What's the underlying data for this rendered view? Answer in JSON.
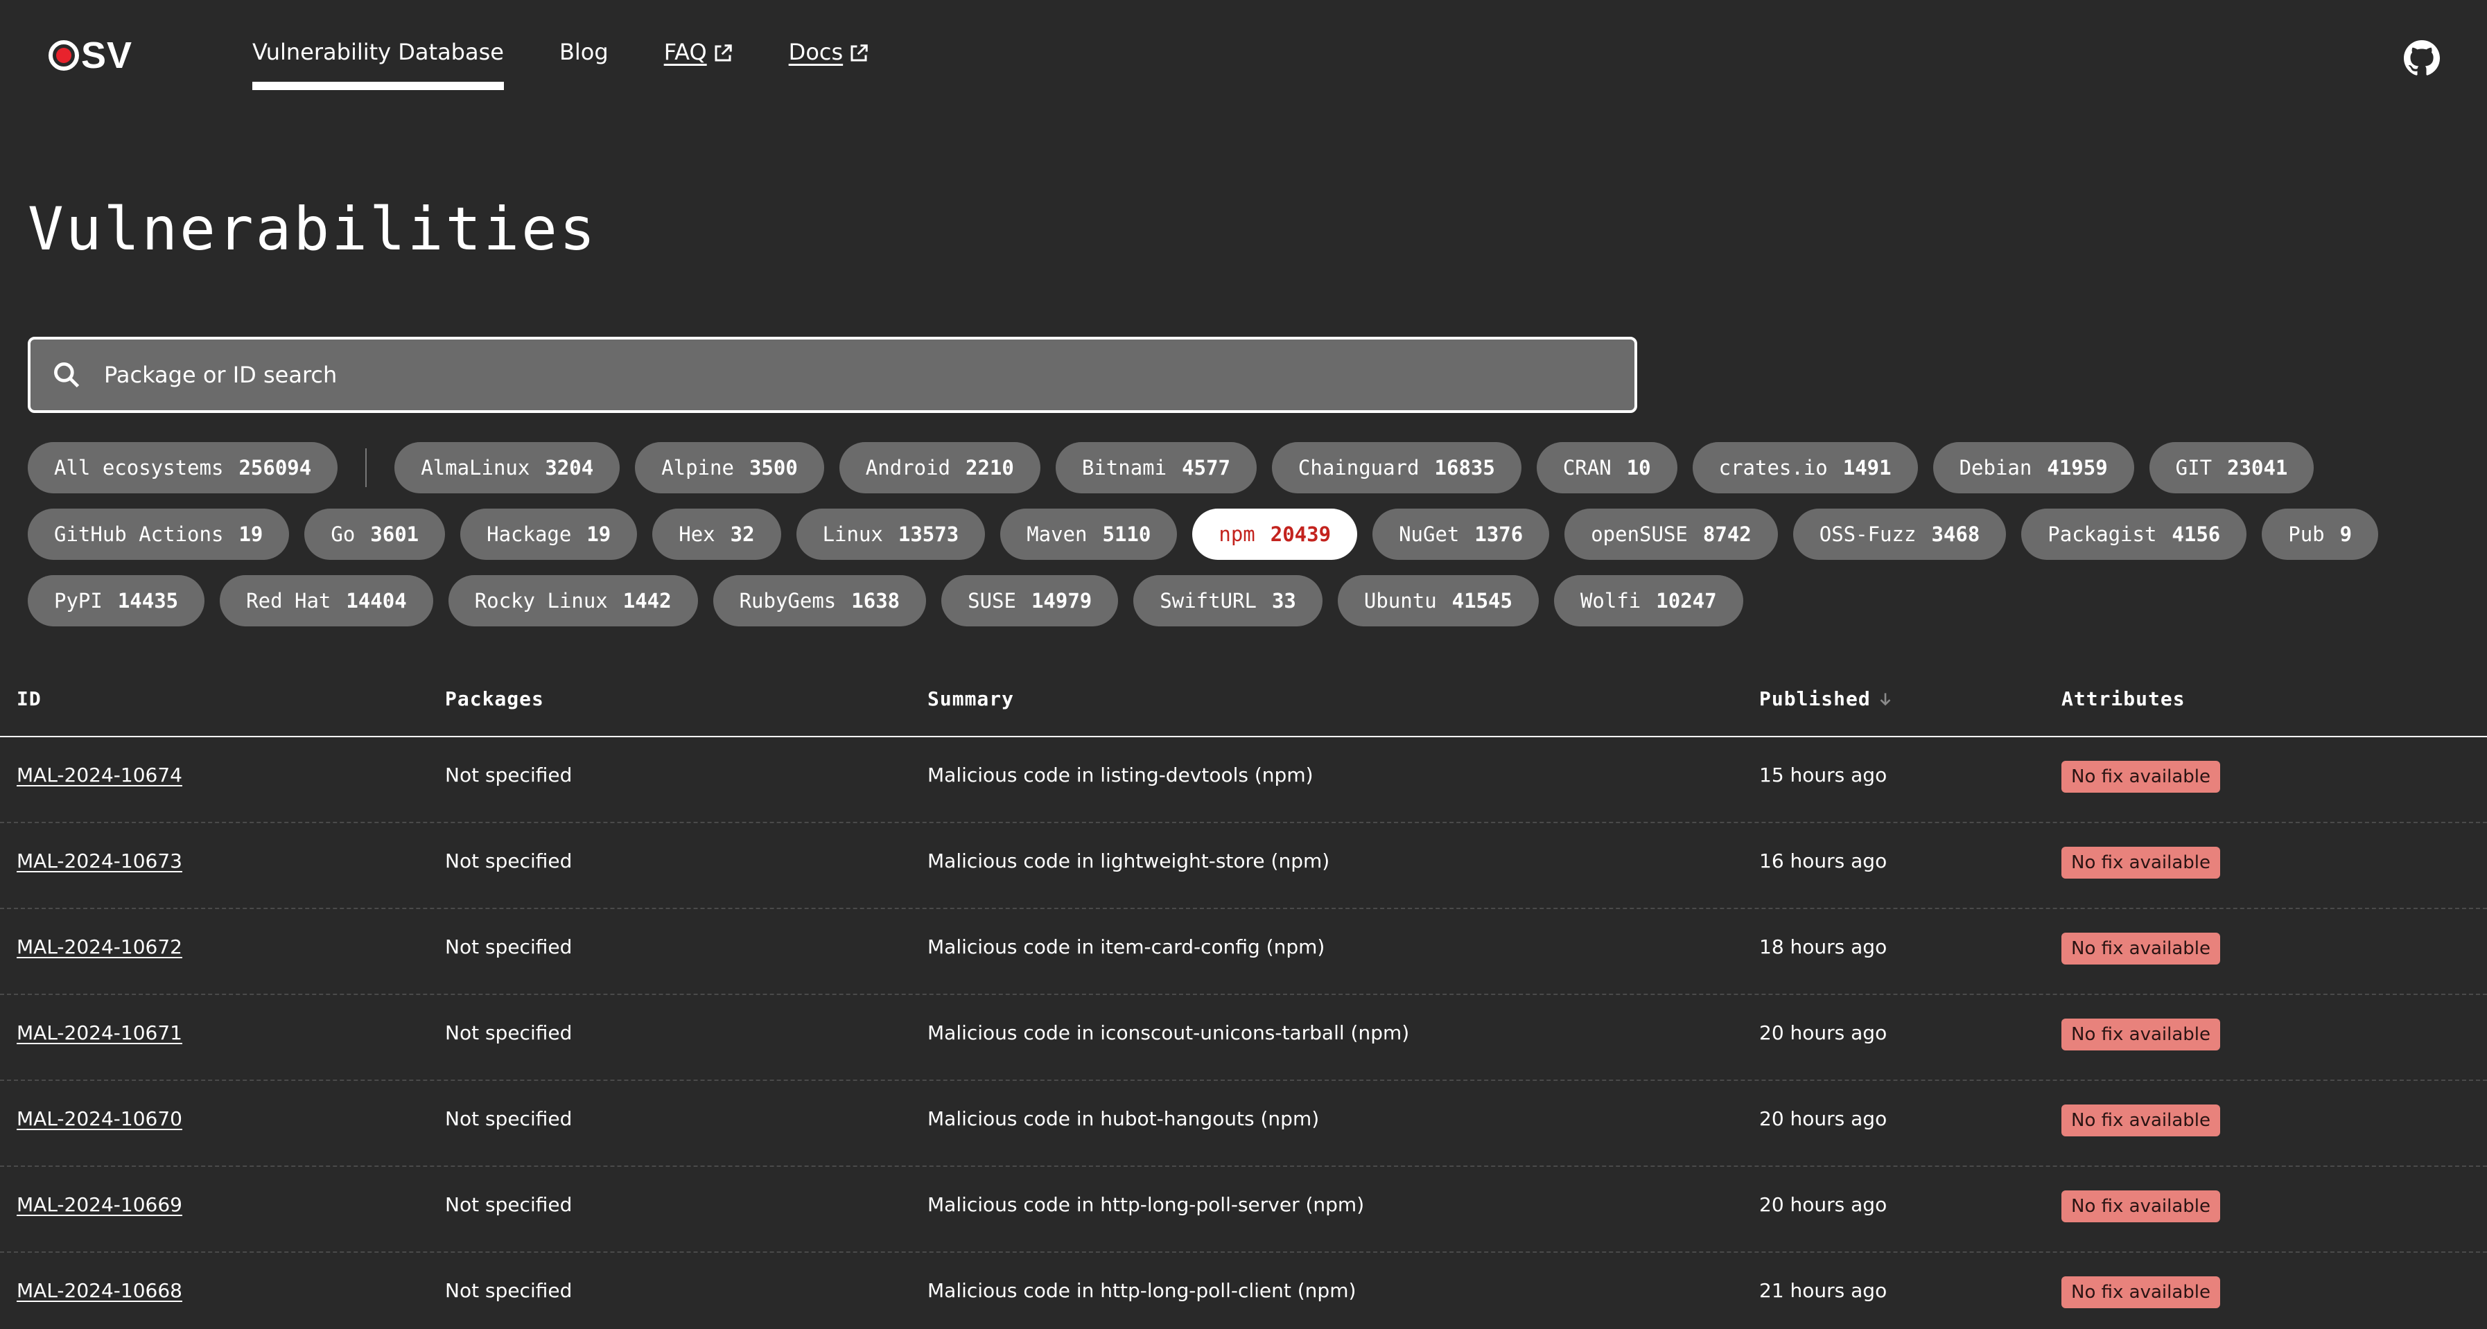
{
  "header": {
    "logo_text": "SV",
    "nav": [
      {
        "label": "Vulnerability Database",
        "active": true,
        "external": false
      },
      {
        "label": "Blog",
        "active": false,
        "external": false
      },
      {
        "label": "FAQ",
        "active": false,
        "external": true
      },
      {
        "label": "Docs",
        "active": false,
        "external": true
      }
    ]
  },
  "page": {
    "title": "Vulnerabilities"
  },
  "search": {
    "placeholder": "Package or ID search",
    "value": ""
  },
  "ecosystems": {
    "all": {
      "label": "All ecosystems",
      "count": "256094"
    },
    "items": [
      {
        "label": "AlmaLinux",
        "count": "3204"
      },
      {
        "label": "Alpine",
        "count": "3500"
      },
      {
        "label": "Android",
        "count": "2210"
      },
      {
        "label": "Bitnami",
        "count": "4577"
      },
      {
        "label": "Chainguard",
        "count": "16835"
      },
      {
        "label": "CRAN",
        "count": "10"
      },
      {
        "label": "crates.io",
        "count": "1491"
      },
      {
        "label": "Debian",
        "count": "41959"
      },
      {
        "label": "GIT",
        "count": "23041"
      },
      {
        "label": "GitHub Actions",
        "count": "19"
      },
      {
        "label": "Go",
        "count": "3601"
      },
      {
        "label": "Hackage",
        "count": "19"
      },
      {
        "label": "Hex",
        "count": "32"
      },
      {
        "label": "Linux",
        "count": "13573"
      },
      {
        "label": "Maven",
        "count": "5110"
      },
      {
        "label": "npm",
        "count": "20439",
        "selected": true
      },
      {
        "label": "NuGet",
        "count": "1376"
      },
      {
        "label": "openSUSE",
        "count": "8742"
      },
      {
        "label": "OSS-Fuzz",
        "count": "3468"
      },
      {
        "label": "Packagist",
        "count": "4156"
      },
      {
        "label": "Pub",
        "count": "9"
      },
      {
        "label": "PyPI",
        "count": "14435"
      },
      {
        "label": "Red Hat",
        "count": "14404"
      },
      {
        "label": "Rocky Linux",
        "count": "1442"
      },
      {
        "label": "RubyGems",
        "count": "1638"
      },
      {
        "label": "SUSE",
        "count": "14979"
      },
      {
        "label": "SwiftURL",
        "count": "33"
      },
      {
        "label": "Ubuntu",
        "count": "41545"
      },
      {
        "label": "Wolfi",
        "count": "10247"
      }
    ]
  },
  "table": {
    "columns": {
      "id": "ID",
      "packages": "Packages",
      "summary": "Summary",
      "published": "Published",
      "attributes": "Attributes"
    },
    "rows": [
      {
        "id": "MAL-2024-10674",
        "packages": "Not specified",
        "summary": "Malicious code in listing-devtools (npm)",
        "published": "15 hours ago",
        "attribute": "No fix available"
      },
      {
        "id": "MAL-2024-10673",
        "packages": "Not specified",
        "summary": "Malicious code in lightweight-store (npm)",
        "published": "16 hours ago",
        "attribute": "No fix available"
      },
      {
        "id": "MAL-2024-10672",
        "packages": "Not specified",
        "summary": "Malicious code in item-card-config (npm)",
        "published": "18 hours ago",
        "attribute": "No fix available"
      },
      {
        "id": "MAL-2024-10671",
        "packages": "Not specified",
        "summary": "Malicious code in iconscout-unicons-tarball (npm)",
        "published": "20 hours ago",
        "attribute": "No fix available"
      },
      {
        "id": "MAL-2024-10670",
        "packages": "Not specified",
        "summary": "Malicious code in hubot-hangouts (npm)",
        "published": "20 hours ago",
        "attribute": "No fix available"
      },
      {
        "id": "MAL-2024-10669",
        "packages": "Not specified",
        "summary": "Malicious code in http-long-poll-server (npm)",
        "published": "20 hours ago",
        "attribute": "No fix available"
      },
      {
        "id": "MAL-2024-10668",
        "packages": "Not specified",
        "summary": "Malicious code in http-long-poll-client (npm)",
        "published": "21 hours ago",
        "attribute": "No fix available"
      }
    ]
  },
  "colors": {
    "background": "#292929",
    "chip": "#6b6b6b",
    "chip_selected_text": "#c3231e",
    "badge": "#e8827c",
    "logo_dot": "#e8232d"
  }
}
